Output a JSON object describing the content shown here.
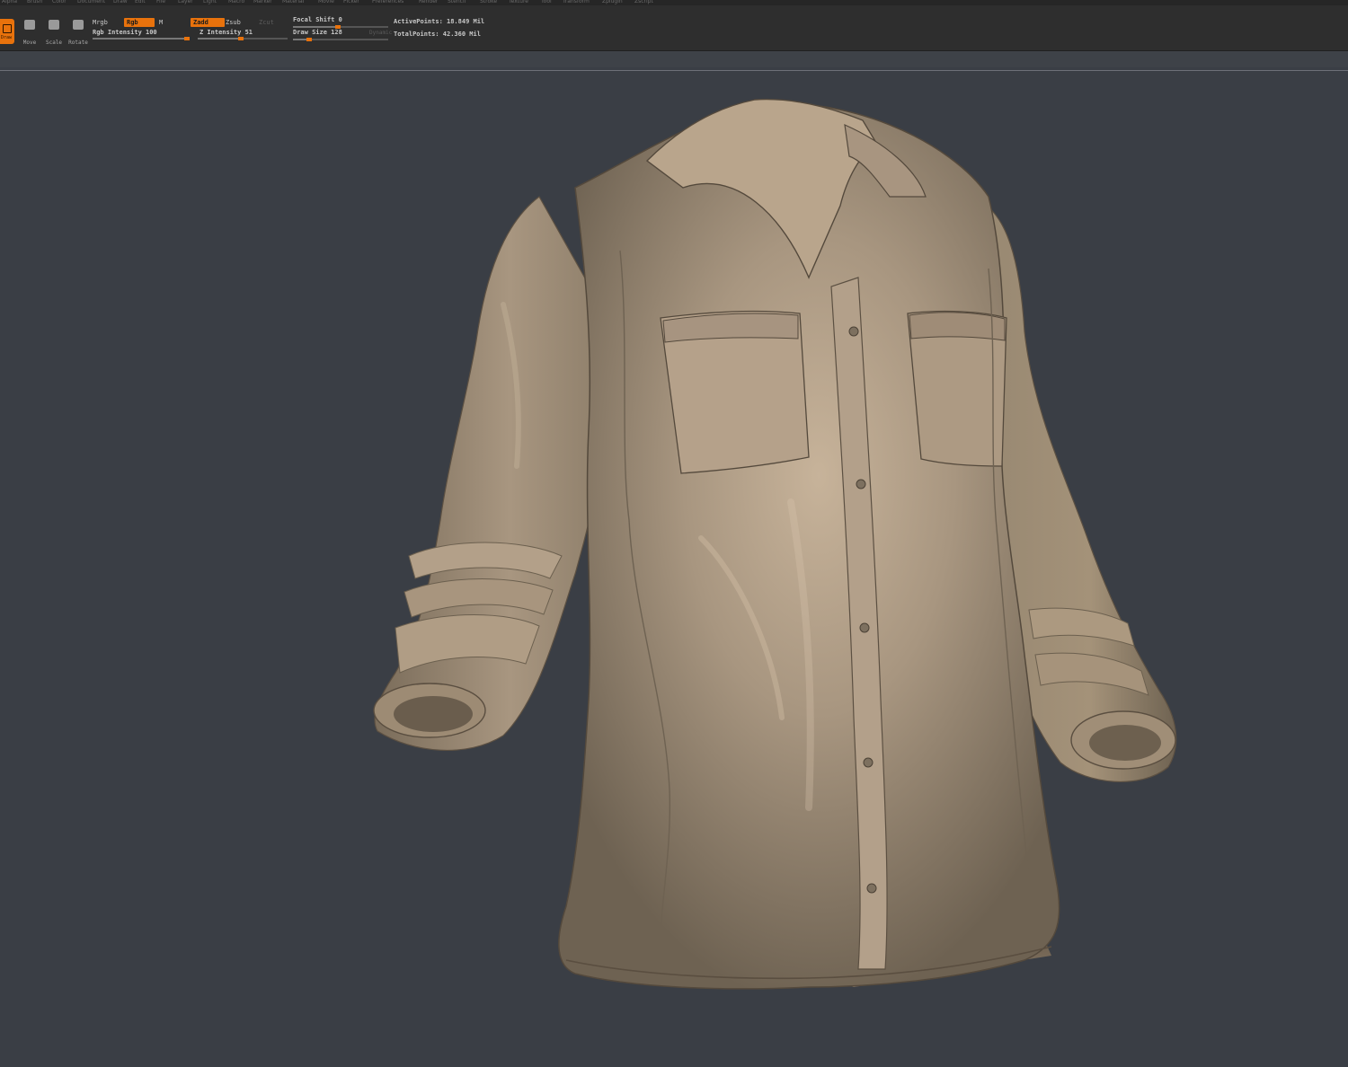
{
  "menu": {
    "items": [
      "Alpha",
      "Brush",
      "Color",
      "Document",
      "Draw",
      "Edit",
      "File",
      "Layer",
      "Light",
      "Macro",
      "Marker",
      "Material",
      "Movie",
      "Picker",
      "Preferences",
      "Render",
      "Stencil",
      "Stroke",
      "Texture",
      "Tool",
      "Transform",
      "Zplugin",
      "Zscript"
    ]
  },
  "toolbar": {
    "draw_label": "Draw",
    "move_label": "Move",
    "scale_label": "Scale",
    "rotate_label": "Rotate",
    "mrgb_label": "Mrgb",
    "rgb_label": "Rgb",
    "m_label": "M",
    "zadd_label": "Zadd",
    "zsub_label": "Zsub",
    "zcut_label": "Zcut",
    "rgb_intensity_label": "Rgb Intensity 100",
    "z_intensity_label": "Z Intensity 51",
    "focal_shift_label": "Focal Shift 0",
    "draw_size_label": "Draw Size 128",
    "dynamic_label": "Dynamic",
    "active_points_label": "ActivePoints: 18.849 Mil",
    "total_points_label": "TotalPoints: 42.360 Mil",
    "rgb_intensity_value": 1.0,
    "z_intensity_value": 0.51,
    "focal_shift_value": 0.5,
    "draw_size_value": 0.2
  },
  "colors": {
    "accent": "#e8720c",
    "toolbar_bg": "#2e2e2e",
    "canvas_bg": "#3a3e45",
    "model_base": "#a89680"
  },
  "viewport": {
    "subject": "shirt-sculpt"
  }
}
